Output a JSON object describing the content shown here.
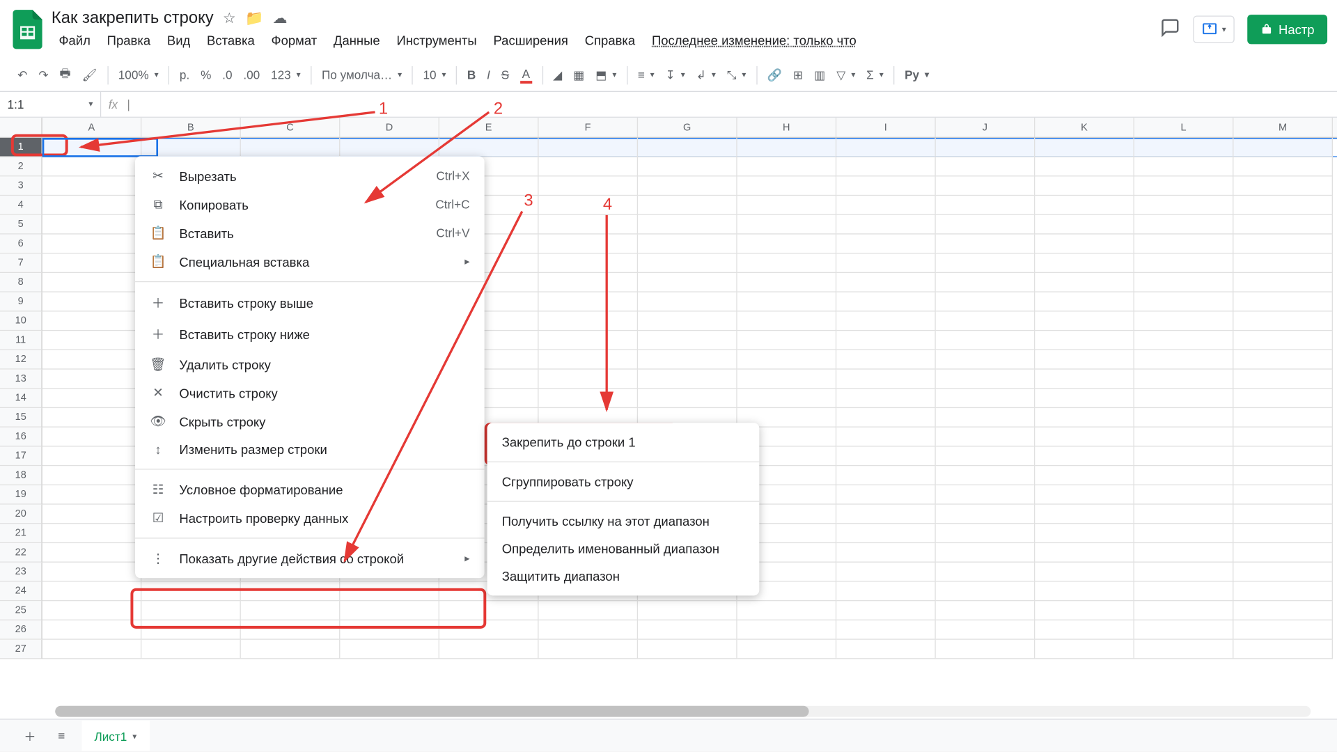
{
  "title": "Как закрепить строку",
  "menus": [
    "Файл",
    "Правка",
    "Вид",
    "Вставка",
    "Формат",
    "Данные",
    "Инструменты",
    "Расширения",
    "Справка"
  ],
  "last_edit": "Последнее изменение: только что",
  "share_label": "Настр",
  "toolbar": {
    "zoom": "100%",
    "currency": "р.",
    "percent": "%",
    "dec_dec": ".0",
    "inc_dec": ".00",
    "numfmt": "123",
    "font": "По умолча…",
    "fontsize": "10",
    "py": "Py"
  },
  "namebox": "1:1",
  "columns": [
    "A",
    "B",
    "C",
    "D",
    "E",
    "F",
    "G",
    "H",
    "I",
    "J",
    "K",
    "L",
    "M"
  ],
  "rowcount": 27,
  "ctx1": {
    "cut": {
      "label": "Вырезать",
      "sc": "Ctrl+X"
    },
    "copy": {
      "label": "Копировать",
      "sc": "Ctrl+C"
    },
    "paste": {
      "label": "Вставить",
      "sc": "Ctrl+V"
    },
    "pastesp": {
      "label": "Специальная вставка"
    },
    "insabove": {
      "label": "Вставить строку выше"
    },
    "insbelow": {
      "label": "Вставить строку ниже"
    },
    "del": {
      "label": "Удалить строку"
    },
    "clear": {
      "label": "Очистить строку"
    },
    "hide": {
      "label": "Скрыть строку"
    },
    "resize": {
      "label": "Изменить размер строки"
    },
    "condfmt": {
      "label": "Условное форматирование"
    },
    "datavalid": {
      "label": "Настроить проверку данных"
    },
    "more": {
      "label": "Показать другие действия со строкой"
    }
  },
  "ctx2": {
    "freeze": "Закрепить до строки 1",
    "group": "Сгруппировать строку",
    "getlink": "Получить ссылку на этот диапазон",
    "named": "Определить именованный диапазон",
    "protect": "Защитить диапазон"
  },
  "anno": {
    "n1": "1",
    "n2": "2",
    "n3": "3",
    "n4": "4"
  },
  "sheet_tab": "Лист1"
}
